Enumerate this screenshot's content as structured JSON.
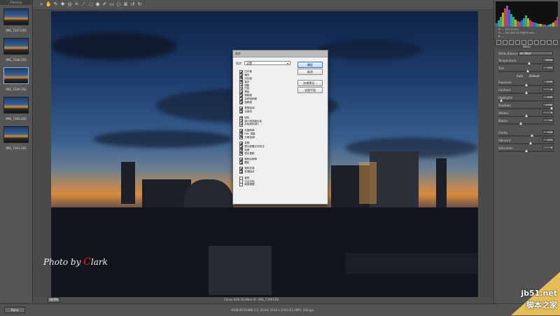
{
  "filmstrip": {
    "header": "Filmstrip",
    "items": [
      {
        "stars": "☆☆☆☆☆",
        "name": "IMG_7337.CR2",
        "selected": false
      },
      {
        "stars": "☆☆☆☆☆",
        "name": "IMG_7338.CR2",
        "selected": false
      },
      {
        "stars": "☆☆☆☆☆",
        "name": "IMG_7339.CR2",
        "selected": true
      },
      {
        "stars": "☆☆☆☆☆",
        "name": "IMG_7340.CR2",
        "selected": false
      },
      {
        "stars": "☆☆☆☆☆",
        "name": "IMG_7341.CR2",
        "selected": false
      }
    ]
  },
  "toolbar": {
    "tools": [
      "zoom-icon",
      "hand-icon",
      "white-balance-icon",
      "color-sampler-icon",
      "target-adjust-icon",
      "crop-icon",
      "straighten-icon",
      "spot-removal-icon",
      "red-eye-icon",
      "adjustment-brush-icon",
      "graduated-filter-icon",
      "radial-filter-icon",
      "preferences-icon",
      "rotate-left-icon",
      "rotate-right-icon"
    ]
  },
  "preview": {
    "watermark_prefix": "Photo by ",
    "watermark_c": "C",
    "watermark_rest": "lark"
  },
  "bottom": {
    "zoom": "18.9%",
    "filename": "Canon EOS 5D Mark III - IMG_7339.CR2",
    "done_button": "Done",
    "workflow": "sRGB IEC61966-2.1; 16 bit; 5616 x 3744 (21.0MP); 240 ppi"
  },
  "histogram": {
    "info": [
      "R: ---   f/11   1/15 s",
      "G: ---   ISO 100   24-70@35 mm",
      "B: ---"
    ]
  },
  "panel": {
    "header": "Basic",
    "wb_label": "White Balance:",
    "wb_value": "As Shot",
    "rows": [
      {
        "label": "Temperature",
        "value": "5000",
        "knob": 0.55
      },
      {
        "label": "Tint",
        "value": "+10",
        "knob": 0.52
      },
      {
        "label": "Exposure",
        "value": "0.00",
        "knob": 0.5
      },
      {
        "label": "Contrast",
        "value": "0",
        "knob": 0.5
      },
      {
        "label": "Highlights",
        "value": "-100",
        "knob": 0.05
      },
      {
        "label": "Shadows",
        "value": "+100",
        "knob": 0.95
      },
      {
        "label": "Whites",
        "value": "0",
        "knob": 0.5
      },
      {
        "label": "Blacks",
        "value": "-21",
        "knob": 0.4
      },
      {
        "label": "Clarity",
        "value": "+20",
        "knob": 0.6
      },
      {
        "label": "Vibrance",
        "value": "+15",
        "knob": 0.58
      },
      {
        "label": "Saturation",
        "value": "0",
        "knob": 0.5
      }
    ],
    "auto_label": "Auto",
    "default_label": "Default"
  },
  "dialog": {
    "title": "同步",
    "sync_label": "同步:",
    "sync_value": "设置",
    "buttons": {
      "ok": "确定",
      "cancel": "取消",
      "save_preset": "存储预设...",
      "manage": "全部不选"
    },
    "groups": [
      [
        {
          "label": "白平衡",
          "checked": true
        },
        {
          "label": "曝光",
          "checked": true
        },
        {
          "label": "对比度",
          "checked": true
        },
        {
          "label": "高光",
          "checked": true
        },
        {
          "label": "阴影",
          "checked": true
        },
        {
          "label": "白色",
          "checked": true
        },
        {
          "label": "黑色",
          "checked": true
        },
        {
          "label": "清晰度",
          "checked": true
        },
        {
          "label": "自然饱和度",
          "checked": true
        },
        {
          "label": "饱和度",
          "checked": true
        }
      ],
      [
        {
          "label": "参数曲线",
          "checked": true
        },
        {
          "label": "点曲线",
          "checked": true
        }
      ],
      [
        {
          "label": "锐化",
          "checked": true
        },
        {
          "label": "减少明亮度杂色",
          "checked": true
        },
        {
          "label": "杂色颜色减少",
          "checked": true
        }
      ],
      [
        {
          "label": "灰度转换",
          "checked": true
        },
        {
          "label": "HSL 调整",
          "checked": true
        },
        {
          "label": "分离色调",
          "checked": true
        }
      ],
      [
        {
          "label": "变换",
          "checked": true
        },
        {
          "label": "镜头配置文件校正",
          "checked": true
        },
        {
          "label": "色差",
          "checked": true
        },
        {
          "label": "镜头晕影",
          "checked": true
        }
      ],
      [
        {
          "label": "裁剪后暗角",
          "checked": true
        },
        {
          "label": "颗粒",
          "checked": true
        }
      ],
      [
        {
          "label": "相机校准",
          "checked": true
        },
        {
          "label": "处理版本",
          "checked": true
        }
      ],
      [
        {
          "label": "裁剪",
          "checked": false
        },
        {
          "label": "污点去除",
          "checked": false
        },
        {
          "label": "局部调整",
          "checked": false
        }
      ]
    ]
  },
  "corner": {
    "site": "jb51.net",
    "brand": "脚本之家"
  },
  "colors": {
    "panel": "#535353",
    "accent": "#3b6fb5",
    "histogram_bg": "#111111"
  }
}
